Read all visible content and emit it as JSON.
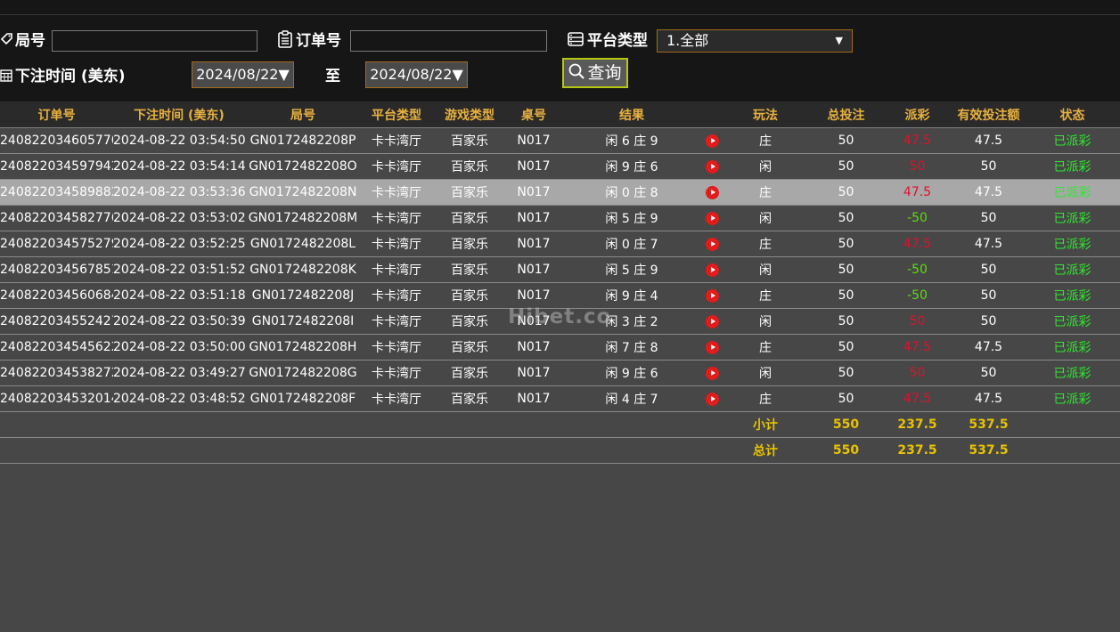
{
  "filters": {
    "round_label": "局号",
    "order_label": "订单号",
    "platform_label": "平台类型",
    "platform_value": "1.全部",
    "time_label": "下注时间 (美东)",
    "date_from": "2024/08/22▼",
    "to_label": "至",
    "date_to": "2024/08/22▼",
    "query_label": "查询"
  },
  "table": {
    "columns": [
      "订单号",
      "下注时间 (美东)",
      "局号",
      "平台类型",
      "游戏类型",
      "桌号",
      "结果",
      "",
      "玩法",
      "总投注",
      "派彩",
      "有效投注额",
      "状态"
    ],
    "rows": [
      {
        "order": "240822034605770",
        "time": "2024-08-22 03:54:50",
        "round": "GN0172482208P",
        "platform": "卡卡湾厅",
        "game": "百家乐",
        "table": "N017",
        "result": "闲 6 庄 9",
        "play": "庄",
        "bet": "50",
        "payout": "47.5",
        "payout_color": "#e0112b",
        "valid": "47.5",
        "status": "已派彩"
      },
      {
        "order": "240822034597942",
        "time": "2024-08-22 03:54:14",
        "round": "GN0172482208O",
        "platform": "卡卡湾厅",
        "game": "百家乐",
        "table": "N017",
        "result": "闲 9 庄 6",
        "play": "闲",
        "bet": "50",
        "payout": "50",
        "payout_color": "#e0112b",
        "valid": "50",
        "status": "已派彩"
      },
      {
        "order": "240822034589882",
        "time": "2024-08-22 03:53:36",
        "round": "GN0172482208N",
        "platform": "卡卡湾厅",
        "game": "百家乐",
        "table": "N017",
        "result": "闲 0 庄 8",
        "play": "庄",
        "bet": "50",
        "payout": "47.5",
        "payout_color": "#e0112b",
        "valid": "47.5",
        "status": "已派彩"
      },
      {
        "order": "240822034582776",
        "time": "2024-08-22 03:53:02",
        "round": "GN0172482208M",
        "platform": "卡卡湾厅",
        "game": "百家乐",
        "table": "N017",
        "result": "闲 5 庄 9",
        "play": "闲",
        "bet": "50",
        "payout": "-50",
        "payout_color": "#5cdc12",
        "valid": "50",
        "status": "已派彩"
      },
      {
        "order": "240822034575279",
        "time": "2024-08-22 03:52:25",
        "round": "GN0172482208L",
        "platform": "卡卡湾厅",
        "game": "百家乐",
        "table": "N017",
        "result": "闲 0 庄 7",
        "play": "庄",
        "bet": "50",
        "payout": "47.5",
        "payout_color": "#e0112b",
        "valid": "47.5",
        "status": "已派彩"
      },
      {
        "order": "240822034567851",
        "time": "2024-08-22 03:51:52",
        "round": "GN0172482208K",
        "platform": "卡卡湾厅",
        "game": "百家乐",
        "table": "N017",
        "result": "闲 5 庄 9",
        "play": "闲",
        "bet": "50",
        "payout": "-50",
        "payout_color": "#5cdc12",
        "valid": "50",
        "status": "已派彩"
      },
      {
        "order": "240822034560684",
        "time": "2024-08-22 03:51:18",
        "round": "GN0172482208J",
        "platform": "卡卡湾厅",
        "game": "百家乐",
        "table": "N017",
        "result": "闲 9 庄 4",
        "play": "庄",
        "bet": "50",
        "payout": "-50",
        "payout_color": "#5cdc12",
        "valid": "50",
        "status": "已派彩"
      },
      {
        "order": "240822034552427",
        "time": "2024-08-22 03:50:39",
        "round": "GN0172482208I",
        "platform": "卡卡湾厅",
        "game": "百家乐",
        "table": "N017",
        "result": "闲 3 庄 2",
        "play": "闲",
        "bet": "50",
        "payout": "50",
        "payout_color": "#e0112b",
        "valid": "50",
        "status": "已派彩"
      },
      {
        "order": "240822034545622",
        "time": "2024-08-22 03:50:00",
        "round": "GN0172482208H",
        "platform": "卡卡湾厅",
        "game": "百家乐",
        "table": "N017",
        "result": "闲 7 庄 8",
        "play": "庄",
        "bet": "50",
        "payout": "47.5",
        "payout_color": "#e0112b",
        "valid": "47.5",
        "status": "已派彩"
      },
      {
        "order": "240822034538272",
        "time": "2024-08-22 03:49:27",
        "round": "GN0172482208G",
        "platform": "卡卡湾厅",
        "game": "百家乐",
        "table": "N017",
        "result": "闲 9 庄 6",
        "play": "闲",
        "bet": "50",
        "payout": "50",
        "payout_color": "#e0112b",
        "valid": "50",
        "status": "已派彩"
      },
      {
        "order": "240822034532014",
        "time": "2024-08-22 03:48:52",
        "round": "GN0172482208F",
        "platform": "卡卡湾厅",
        "game": "百家乐",
        "table": "N017",
        "result": "闲 4 庄 7",
        "play": "庄",
        "bet": "50",
        "payout": "47.5",
        "payout_color": "#e0112b",
        "valid": "47.5",
        "status": "已派彩"
      }
    ],
    "subtotal": {
      "label": "小计",
      "bet": "550",
      "payout": "237.5",
      "valid": "537.5"
    },
    "total": {
      "label": "总计",
      "bet": "550",
      "payout": "237.5",
      "valid": "537.5"
    },
    "selected_index": 2
  },
  "watermark": "Hibet.co",
  "colors": {
    "header_text": "#e8b13f",
    "status_green": "#2ee82e",
    "sum_yellow": "#e8c300",
    "accent_border": "#a46a1d",
    "query_border": "#b6c80e"
  }
}
